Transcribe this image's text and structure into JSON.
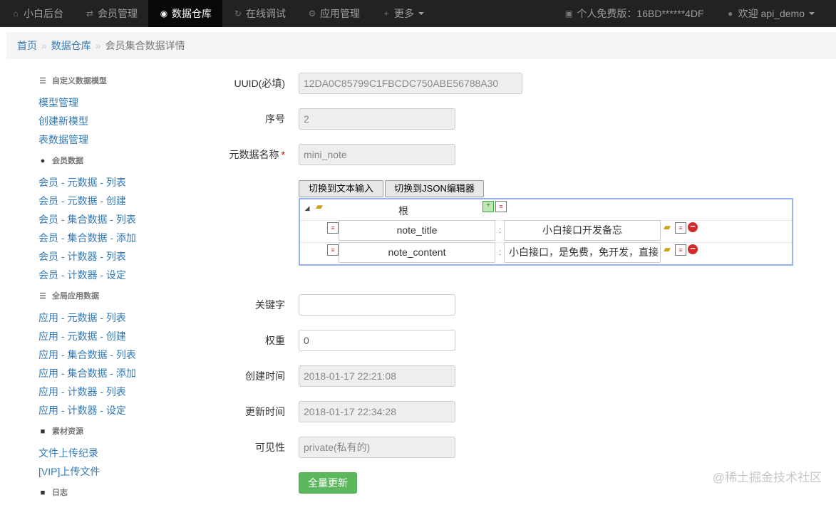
{
  "nav": {
    "items": [
      {
        "label": "小白后台",
        "icon": "home-icon"
      },
      {
        "label": "会员管理",
        "icon": "shuffle-icon"
      },
      {
        "label": "数据仓库",
        "icon": "globe-icon"
      },
      {
        "label": "在线调试",
        "icon": "refresh-icon"
      },
      {
        "label": "应用管理",
        "icon": "gear-icon"
      },
      {
        "label": "更多",
        "icon": "plus-icon"
      }
    ],
    "license": "个人免费版：16BD******4DF",
    "welcome": "欢迎 api_demo"
  },
  "breadcrumb": {
    "home": "首页",
    "section": "数据仓库",
    "current": "会员集合数据详情",
    "sep": "»"
  },
  "sidebar": {
    "groups": [
      {
        "header": "自定义数据模型",
        "icon": "list-icon",
        "links": [
          "模型管理",
          "创建新模型",
          "表数据管理"
        ]
      },
      {
        "header": "会员数据",
        "icon": "user-icon",
        "links": [
          "会员 - 元数据 - 列表",
          "会员 - 元数据 - 创建",
          "会员 - 集合数据 - 列表",
          "会员 - 集合数据 - 添加",
          "会员 - 计数器 - 列表",
          "会员 - 计数器 - 设定"
        ]
      },
      {
        "header": "全局应用数据",
        "icon": "list-icon",
        "links": [
          "应用 - 元数据 - 列表",
          "应用 - 元数据 - 创建",
          "应用 - 集合数据 - 列表",
          "应用 - 集合数据 - 添加",
          "应用 - 计数器 - 列表",
          "应用 - 计数器 - 设定"
        ]
      },
      {
        "header": "素材资源",
        "icon": "book-icon",
        "links": [
          "文件上传纪录",
          "[VIP]上传文件"
        ]
      },
      {
        "header": "日志",
        "icon": "book-icon",
        "links": []
      }
    ]
  },
  "form": {
    "uuid": {
      "label": "UUID(必填)",
      "value": "12DA0C85799C1FBCDC750ABE56788A30"
    },
    "seq": {
      "label": "序号",
      "value": "2"
    },
    "meta_name": {
      "label": "元数据名称",
      "required": "*",
      "value": "mini_note"
    },
    "keyword": {
      "label": "关键字",
      "value": ""
    },
    "weight": {
      "label": "权重",
      "value": "0"
    },
    "created": {
      "label": "创建时间",
      "value": "2018-01-17 22:21:08"
    },
    "updated": {
      "label": "更新时间",
      "value": "2018-01-17 22:34:28"
    },
    "visibility": {
      "label": "可见性",
      "value": "private(私有的)"
    },
    "submit": "全量更新"
  },
  "json_editor": {
    "btn_text": "切换到文本输入",
    "btn_json": "切换到JSON编辑器",
    "root": "根",
    "separator": ":",
    "rows": [
      {
        "key": "note_title",
        "value": "小白接口开发备忘"
      },
      {
        "key": "note_content",
        "value": "小白接口，是免费，免开发，直接"
      }
    ]
  },
  "watermark": "@稀土掘金技术社区",
  "colors": {
    "navbar": "#222222",
    "link": "#337ab7",
    "success": "#5cb85c",
    "editor_border": "#97b0f8"
  }
}
